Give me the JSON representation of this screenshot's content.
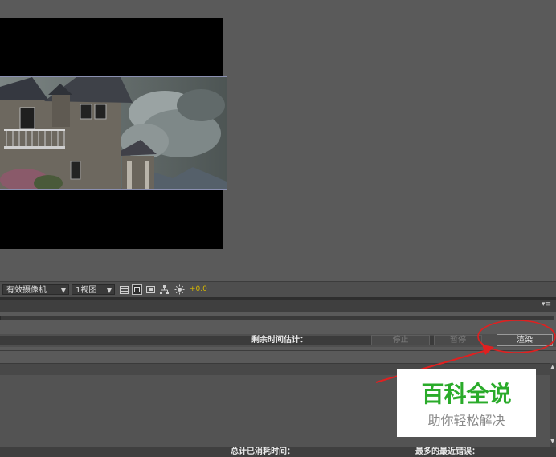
{
  "viewer": {
    "camera_select": "有效摄像机",
    "view_select": "1视图",
    "exposure_value": "+0.0",
    "icons": [
      "grid-icon",
      "region-of-interest-icon",
      "transparency-icon",
      "flowchart-icon",
      "exposure-icon"
    ]
  },
  "render_queue": {
    "remaining_time_label": "剩余时间估计：",
    "stop_label": "停止",
    "pause_label": "暂停",
    "render_label": "渲染",
    "elapsed_total_label": "总计已消耗时间：",
    "recent_error_label": "最多的最近错误："
  },
  "watermark": {
    "title": "百科全说",
    "subtitle": "助你轻松解决"
  },
  "colors": {
    "exposure_accent": "#d8b800",
    "annotation_red": "#e02020",
    "watermark_green": "#2aab2a"
  }
}
